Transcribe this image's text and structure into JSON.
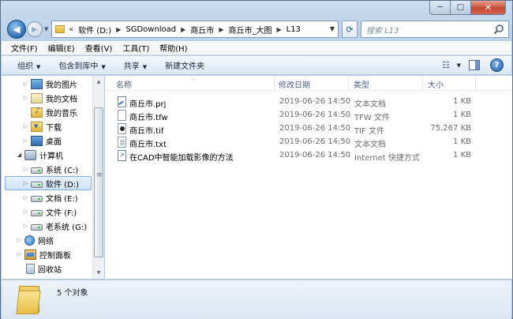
{
  "window": {
    "controls": {
      "minimize": "─",
      "maximize": "□",
      "close": "✕"
    }
  },
  "nav": {
    "back_icon": "back-arrow-icon",
    "forward_icon": "forward-arrow-icon",
    "overflow": "«",
    "breadcrumbs": [
      "软件 (D:)",
      "SGDownload",
      "商丘市",
      "商丘市_大图",
      "L13"
    ],
    "refresh_icon": "refresh-icon",
    "search_placeholder": "搜索 L13"
  },
  "menu": [
    "文件(F)",
    "编辑(E)",
    "查看(V)",
    "工具(T)",
    "帮助(H)"
  ],
  "toolbar": {
    "organize": "组织",
    "include_library": "包含到库中",
    "share": "共享",
    "new_folder": "新建文件夹",
    "help_label": "?"
  },
  "sidebar": {
    "items": [
      {
        "label": "我的图片",
        "icon": "pictures-icon"
      },
      {
        "label": "我的文档",
        "icon": "documents-icon"
      },
      {
        "label": "我的音乐",
        "icon": "music-icon"
      },
      {
        "label": "下载",
        "icon": "downloads-icon"
      },
      {
        "label": "桌面",
        "icon": "desktop-icon"
      },
      {
        "label": "计算机",
        "icon": "computer-icon"
      },
      {
        "label": "系统 (C:)",
        "icon": "drive-icon"
      },
      {
        "label": "软件 (D:)",
        "icon": "drive-icon"
      },
      {
        "label": "文档 (E:)",
        "icon": "drive-icon"
      },
      {
        "label": "文件 (F:)",
        "icon": "drive-icon"
      },
      {
        "label": "老系统 (G:)",
        "icon": "drive-icon"
      },
      {
        "label": "网络",
        "icon": "network-icon"
      },
      {
        "label": "控制面板",
        "icon": "control-panel-icon"
      },
      {
        "label": "回收站",
        "icon": "recycle-bin-icon"
      }
    ]
  },
  "columns": {
    "name": "名称",
    "date": "修改日期",
    "type": "类型",
    "size": "大小"
  },
  "files": [
    {
      "name": "商丘市.prj",
      "date": "2019-06-26 14:50",
      "type": "文本文档",
      "size": "1 KB"
    },
    {
      "name": "商丘市.tfw",
      "date": "2019-06-26 14:50",
      "type": "TFW 文件",
      "size": "1 KB"
    },
    {
      "name": "商丘市.tif",
      "date": "2019-06-26 14:50",
      "type": "TIF 文件",
      "size": "75,267 KB"
    },
    {
      "name": "商丘市.txt",
      "date": "2019-06-26 14:50",
      "type": "文本文档",
      "size": "1 KB"
    },
    {
      "name": "在CAD中智能加载影像的方法",
      "date": "2019-06-26 14:50",
      "type": "Internet 快捷方式",
      "size": "1 KB"
    }
  ],
  "details": {
    "status": "5 个对象"
  }
}
